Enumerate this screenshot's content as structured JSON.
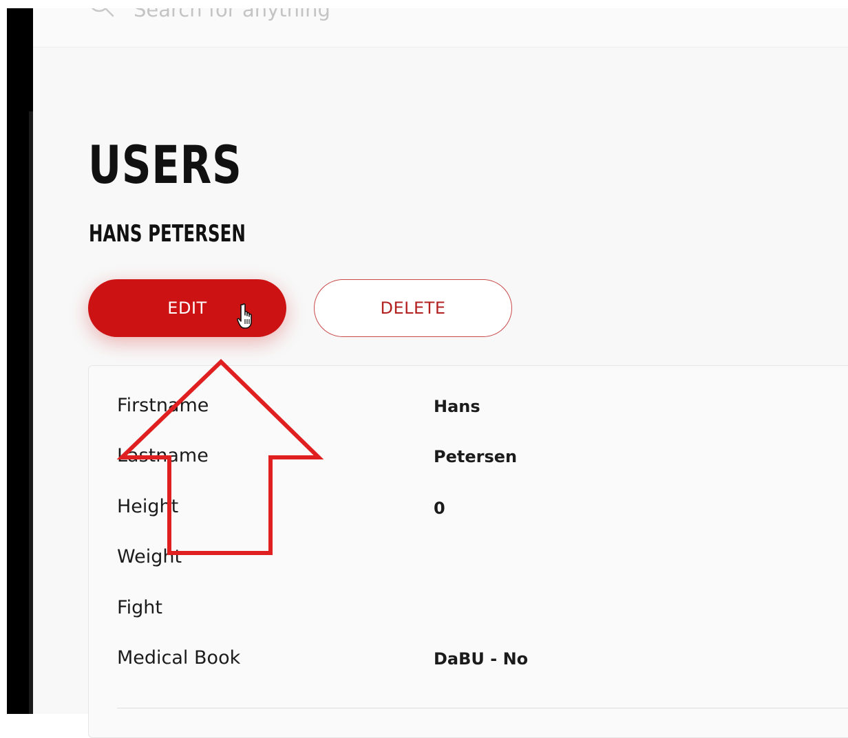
{
  "search": {
    "placeholder": "Search for anything"
  },
  "page": {
    "title": "USERS",
    "user_name": "HANS PETERSEN"
  },
  "actions": {
    "edit_label": "EDIT",
    "delete_label": "DELETE"
  },
  "details": {
    "rows": [
      {
        "label": "Firstname",
        "value": "Hans"
      },
      {
        "label": "Lastname",
        "value": "Petersen"
      },
      {
        "label": "Height",
        "value": "0"
      },
      {
        "label": "Weight",
        "value": ""
      },
      {
        "label": "Fight",
        "value": ""
      },
      {
        "label": "Medical Book",
        "value": "DaBU - No"
      }
    ]
  },
  "colors": {
    "primary_red": "#cc1212",
    "annotation_red": "#e02020",
    "text_dark": "#111111"
  },
  "icons": {
    "search": "search-icon",
    "cursor": "hand-cursor-icon",
    "annotation": "up-arrow-annotation"
  }
}
